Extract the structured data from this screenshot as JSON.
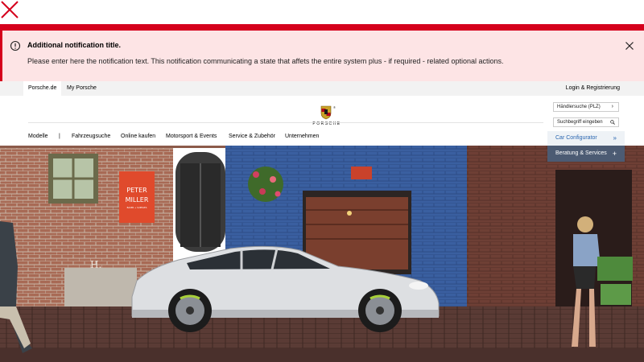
{
  "notification": {
    "title": "Additional notification title.",
    "text": "Please enter here the notification text. This notification communicating a state that affets the entire system plus - if required - related optional actions."
  },
  "utility_nav": {
    "tabs": [
      {
        "label": "Porsche.de"
      },
      {
        "label": "My Porsche"
      }
    ],
    "login": "Login & Registrierung"
  },
  "header": {
    "brand": "PORSCHE",
    "reg_mark": "®"
  },
  "main_nav": {
    "items": [
      {
        "label": "Modelle"
      },
      {
        "label": "|"
      },
      {
        "label": "Fahrzeugsuche"
      },
      {
        "label": "Online kaufen"
      },
      {
        "label": "Motorsport & Events"
      },
      {
        "label": "Service & Zubehör"
      },
      {
        "label": "Unternehmen"
      }
    ]
  },
  "side_panel": {
    "dealer_search": "Händlersuche (PLZ)",
    "dealer_chevron": "›",
    "search_placeholder": "Suchbegriff eingeben",
    "configurator": "Car Configurator",
    "configurator_arrow": "»",
    "beratung": "Beratung & Services",
    "beratung_plus": "+"
  },
  "hero": {
    "sign": {
      "line1": "PETER",
      "line2": "MILLER",
      "line3": "BAKER + SUPPLIES"
    },
    "plaque": "H."
  },
  "colors": {
    "accent_red": "#d5001c",
    "notification_bg": "#fde4e5",
    "configurator_blue": "#2a66b0",
    "panel_dark": "#4c5b73"
  }
}
